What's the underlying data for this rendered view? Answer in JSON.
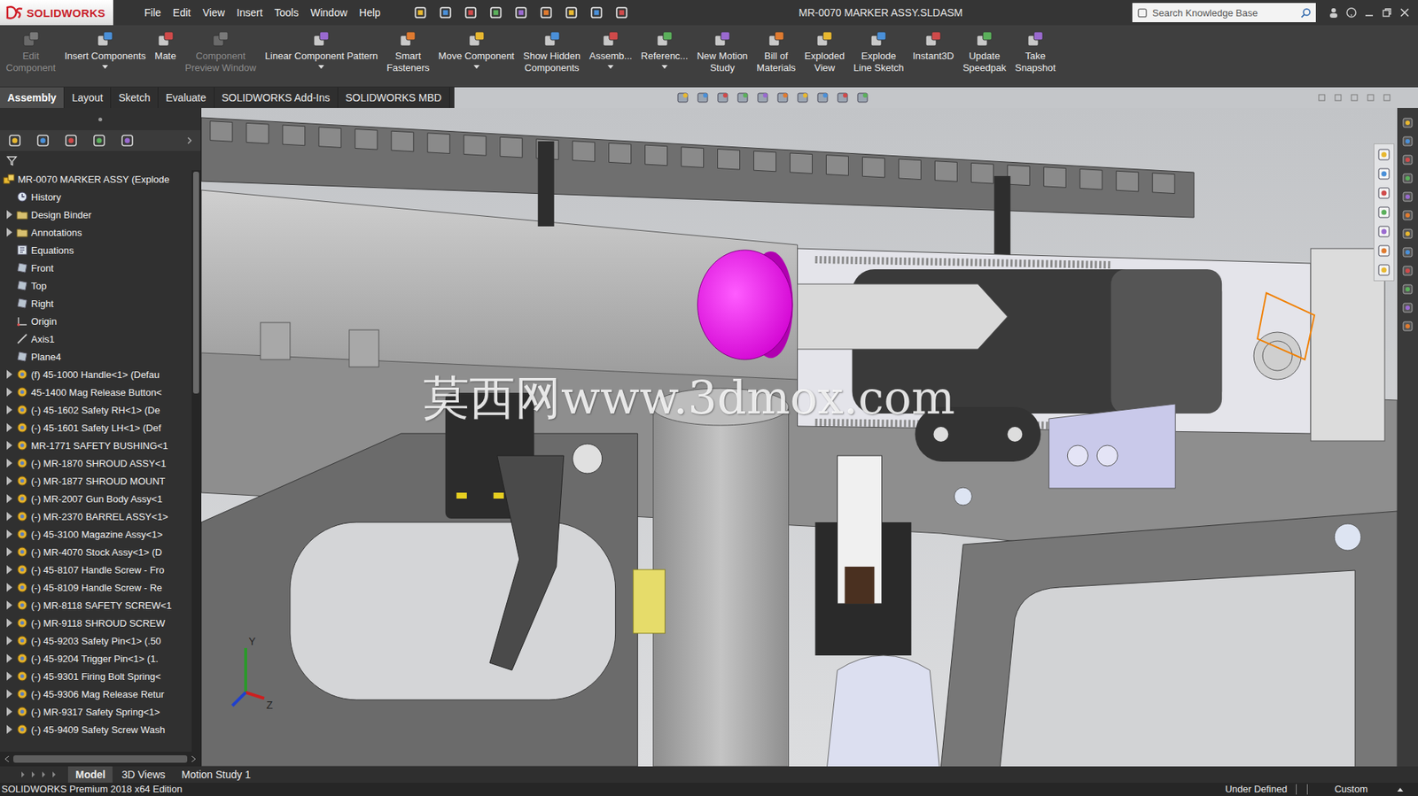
{
  "window": {
    "app": "SOLIDWORKS",
    "title": "MR-0070 MARKER ASSY.SLDASM"
  },
  "menu": [
    "File",
    "Edit",
    "View",
    "Insert",
    "Tools",
    "Window",
    "Help"
  ],
  "search": {
    "placeholder": "Search Knowledge Base"
  },
  "commands": [
    {
      "lines": [
        "Edit",
        "Component"
      ],
      "disabled": true,
      "dropdown": false
    },
    {
      "lines": [
        "Insert Components"
      ],
      "disabled": false,
      "dropdown": true
    },
    {
      "lines": [
        "Mate"
      ],
      "disabled": false,
      "dropdown": false
    },
    {
      "lines": [
        "Component",
        "Preview Window"
      ],
      "disabled": true,
      "dropdown": false
    },
    {
      "lines": [
        "Linear Component Pattern"
      ],
      "disabled": false,
      "dropdown": true
    },
    {
      "lines": [
        "Smart",
        "Fasteners"
      ],
      "disabled": false,
      "dropdown": false
    },
    {
      "lines": [
        "Move Component"
      ],
      "disabled": false,
      "dropdown": true
    },
    {
      "lines": [
        "Show Hidden",
        "Components"
      ],
      "disabled": false,
      "dropdown": false
    },
    {
      "lines": [
        "Assemb..."
      ],
      "disabled": false,
      "dropdown": true
    },
    {
      "lines": [
        "Referenc..."
      ],
      "disabled": false,
      "dropdown": true
    },
    {
      "lines": [
        "New Motion",
        "Study"
      ],
      "disabled": false,
      "dropdown": false
    },
    {
      "lines": [
        "Bill of",
        "Materials"
      ],
      "disabled": false,
      "dropdown": false
    },
    {
      "lines": [
        "Exploded",
        "View"
      ],
      "disabled": false,
      "dropdown": false
    },
    {
      "lines": [
        "Explode",
        "Line Sketch"
      ],
      "disabled": false,
      "dropdown": false
    },
    {
      "lines": [
        "Instant3D"
      ],
      "disabled": false,
      "dropdown": false
    },
    {
      "lines": [
        "Update",
        "Speedpak"
      ],
      "disabled": false,
      "dropdown": false
    },
    {
      "lines": [
        "Take",
        "Snapshot"
      ],
      "disabled": false,
      "dropdown": false
    }
  ],
  "tabs": [
    {
      "label": "Assembly",
      "selected": true
    },
    {
      "label": "Layout",
      "selected": false
    },
    {
      "label": "Sketch",
      "selected": false
    },
    {
      "label": "Evaluate",
      "selected": false
    },
    {
      "label": "SOLIDWORKS Add-Ins",
      "selected": false
    },
    {
      "label": "SOLIDWORKS MBD",
      "selected": false
    }
  ],
  "tree": {
    "root": {
      "label": "MR-0070 MARKER ASSY (Explode"
    },
    "items": [
      {
        "label": "History",
        "kind": "history",
        "expandable": false
      },
      {
        "label": "Design Binder",
        "kind": "folder",
        "expandable": true
      },
      {
        "label": "Annotations",
        "kind": "folder",
        "expandable": true
      },
      {
        "label": "Equations",
        "kind": "equations",
        "expandable": false
      },
      {
        "label": "Front",
        "kind": "plane",
        "expandable": false
      },
      {
        "label": "Top",
        "kind": "plane",
        "expandable": false
      },
      {
        "label": "Right",
        "kind": "plane",
        "expandable": false
      },
      {
        "label": "Origin",
        "kind": "origin",
        "expandable": false
      },
      {
        "label": "Axis1",
        "kind": "axis",
        "expandable": false
      },
      {
        "label": "Plane4",
        "kind": "plane",
        "expandable": false
      },
      {
        "label": "(f) 45-1000 Handle<1> (Defau",
        "kind": "component",
        "expandable": true
      },
      {
        "label": "45-1400 Mag Release Button<",
        "kind": "component",
        "expandable": true
      },
      {
        "label": "(-) 45-1602 Safety RH<1> (De",
        "kind": "component",
        "expandable": true
      },
      {
        "label": "(-) 45-1601 Safety LH<1> (Def",
        "kind": "component",
        "expandable": true
      },
      {
        "label": "MR-1771 SAFETY BUSHING<1",
        "kind": "component",
        "expandable": true
      },
      {
        "label": "(-) MR-1870 SHROUD ASSY<1",
        "kind": "component",
        "expandable": true
      },
      {
        "label": "(-) MR-1877 SHROUD MOUNT",
        "kind": "component",
        "expandable": true
      },
      {
        "label": "(-) MR-2007 Gun Body Assy<1",
        "kind": "component",
        "expandable": true
      },
      {
        "label": "(-) MR-2370 BARREL ASSY<1>",
        "kind": "component",
        "expandable": true
      },
      {
        "label": "(-) 45-3100 Magazine Assy<1>",
        "kind": "component",
        "expandable": true
      },
      {
        "label": "(-) MR-4070 Stock Assy<1> (D",
        "kind": "component",
        "expandable": true
      },
      {
        "label": "(-) 45-8107 Handle Screw - Fro",
        "kind": "component",
        "expandable": true
      },
      {
        "label": "(-) 45-8109 Handle Screw - Re",
        "kind": "component",
        "expandable": true
      },
      {
        "label": "(-) MR-8118 SAFETY SCREW<1",
        "kind": "component",
        "expandable": true
      },
      {
        "label": "(-) MR-9118 SHROUD SCREW",
        "kind": "component",
        "expandable": true
      },
      {
        "label": "(-) 45-9203 Safety Pin<1> (.50",
        "kind": "component",
        "expandable": true
      },
      {
        "label": "(-) 45-9204 Trigger Pin<1> (1.",
        "kind": "component",
        "expandable": true
      },
      {
        "label": "(-) 45-9301 Firing Bolt Spring<",
        "kind": "component",
        "expandable": true
      },
      {
        "label": "(-) 45-9306 Mag Release Retur",
        "kind": "component",
        "expandable": true
      },
      {
        "label": "(-) MR-9317 Safety Spring<1>",
        "kind": "component",
        "expandable": true
      },
      {
        "label": "(-) 45-9409 Safety Screw Wash",
        "kind": "component",
        "expandable": true
      }
    ]
  },
  "graphics": {
    "watermark": "莫西网www.3dmox.com",
    "triad": [
      "Y",
      "Z"
    ]
  },
  "bottom_tabs": [
    {
      "label": "Model",
      "selected": true
    },
    {
      "label": "3D Views",
      "selected": false
    },
    {
      "label": "Motion Study 1",
      "selected": false
    }
  ],
  "status_bar": {
    "edition": "SOLIDWORKS Premium 2018 x64 Edition",
    "state": "Under Defined",
    "units": "Custom"
  }
}
